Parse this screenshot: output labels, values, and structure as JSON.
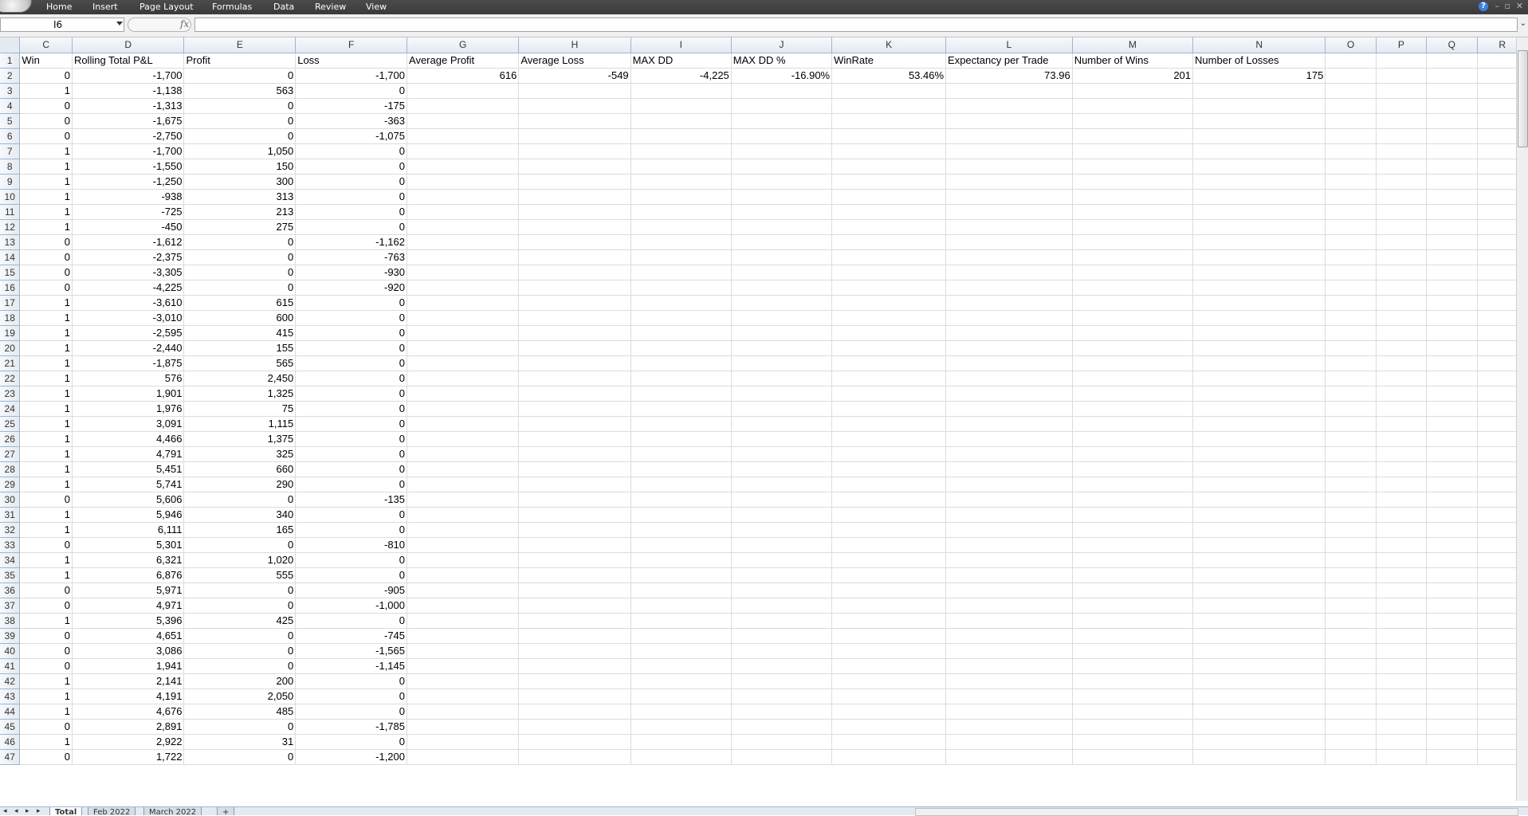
{
  "menu": {
    "tabs": [
      "Home",
      "Insert",
      "Page Layout",
      "Formulas",
      "Data",
      "Review",
      "View"
    ]
  },
  "formula_bar": {
    "name_box": "I6",
    "fx_symbol": "fx",
    "formula": ""
  },
  "columns": [
    "C",
    "D",
    "E",
    "F",
    "G",
    "H",
    "I",
    "J",
    "K",
    "L",
    "M",
    "N",
    "O",
    "P",
    "Q",
    "R"
  ],
  "header_row": {
    "row": "1",
    "cells": [
      "Win",
      "Rolling Total P&L",
      "Profit",
      "Loss",
      "Average Profit",
      "Average Loss",
      "MAX DD",
      "MAX DD %",
      "WinRate",
      "Expectancy per Trade",
      "Number of Wins",
      "Number of Losses",
      "",
      "",
      "",
      ""
    ]
  },
  "summary_row": {
    "row": "2",
    "cells": [
      "0",
      "-1,700",
      "0",
      "-1,700",
      "616",
      "-549",
      "-4,225",
      "-16.90%",
      "53.46%",
      "73.96",
      "201",
      "175",
      "",
      "",
      "",
      ""
    ]
  },
  "data_rows": [
    [
      "3",
      "1",
      "-1,138",
      "563",
      "0"
    ],
    [
      "4",
      "0",
      "-1,313",
      "0",
      "-175"
    ],
    [
      "5",
      "0",
      "-1,675",
      "0",
      "-363"
    ],
    [
      "6",
      "0",
      "-2,750",
      "0",
      "-1,075"
    ],
    [
      "7",
      "1",
      "-1,700",
      "1,050",
      "0"
    ],
    [
      "8",
      "1",
      "-1,550",
      "150",
      "0"
    ],
    [
      "9",
      "1",
      "-1,250",
      "300",
      "0"
    ],
    [
      "10",
      "1",
      "-938",
      "313",
      "0"
    ],
    [
      "11",
      "1",
      "-725",
      "213",
      "0"
    ],
    [
      "12",
      "1",
      "-450",
      "275",
      "0"
    ],
    [
      "13",
      "0",
      "-1,612",
      "0",
      "-1,162"
    ],
    [
      "14",
      "0",
      "-2,375",
      "0",
      "-763"
    ],
    [
      "15",
      "0",
      "-3,305",
      "0",
      "-930"
    ],
    [
      "16",
      "0",
      "-4,225",
      "0",
      "-920"
    ],
    [
      "17",
      "1",
      "-3,610",
      "615",
      "0"
    ],
    [
      "18",
      "1",
      "-3,010",
      "600",
      "0"
    ],
    [
      "19",
      "1",
      "-2,595",
      "415",
      "0"
    ],
    [
      "20",
      "1",
      "-2,440",
      "155",
      "0"
    ],
    [
      "21",
      "1",
      "-1,875",
      "565",
      "0"
    ],
    [
      "22",
      "1",
      "576",
      "2,450",
      "0"
    ],
    [
      "23",
      "1",
      "1,901",
      "1,325",
      "0"
    ],
    [
      "24",
      "1",
      "1,976",
      "75",
      "0"
    ],
    [
      "25",
      "1",
      "3,091",
      "1,115",
      "0"
    ],
    [
      "26",
      "1",
      "4,466",
      "1,375",
      "0"
    ],
    [
      "27",
      "1",
      "4,791",
      "325",
      "0"
    ],
    [
      "28",
      "1",
      "5,451",
      "660",
      "0"
    ],
    [
      "29",
      "1",
      "5,741",
      "290",
      "0"
    ],
    [
      "30",
      "0",
      "5,606",
      "0",
      "-135"
    ],
    [
      "31",
      "1",
      "5,946",
      "340",
      "0"
    ],
    [
      "32",
      "1",
      "6,111",
      "165",
      "0"
    ],
    [
      "33",
      "0",
      "5,301",
      "0",
      "-810"
    ],
    [
      "34",
      "1",
      "6,321",
      "1,020",
      "0"
    ],
    [
      "35",
      "1",
      "6,876",
      "555",
      "0"
    ],
    [
      "36",
      "0",
      "5,971",
      "0",
      "-905"
    ],
    [
      "37",
      "0",
      "4,971",
      "0",
      "-1,000"
    ],
    [
      "38",
      "1",
      "5,396",
      "425",
      "0"
    ],
    [
      "39",
      "0",
      "4,651",
      "0",
      "-745"
    ],
    [
      "40",
      "0",
      "3,086",
      "0",
      "-1,565"
    ],
    [
      "41",
      "0",
      "1,941",
      "0",
      "-1,145"
    ],
    [
      "42",
      "1",
      "2,141",
      "200",
      "0"
    ],
    [
      "43",
      "1",
      "4,191",
      "2,050",
      "0"
    ],
    [
      "44",
      "1",
      "4,676",
      "485",
      "0"
    ],
    [
      "45",
      "0",
      "2,891",
      "0",
      "-1,785"
    ],
    [
      "46",
      "1",
      "2,922",
      "31",
      "0"
    ],
    [
      "47",
      "0",
      "1,722",
      "0",
      "-1,200"
    ]
  ],
  "sheet_tabs": [
    "Total",
    "Feb 2022",
    "March 2022"
  ]
}
